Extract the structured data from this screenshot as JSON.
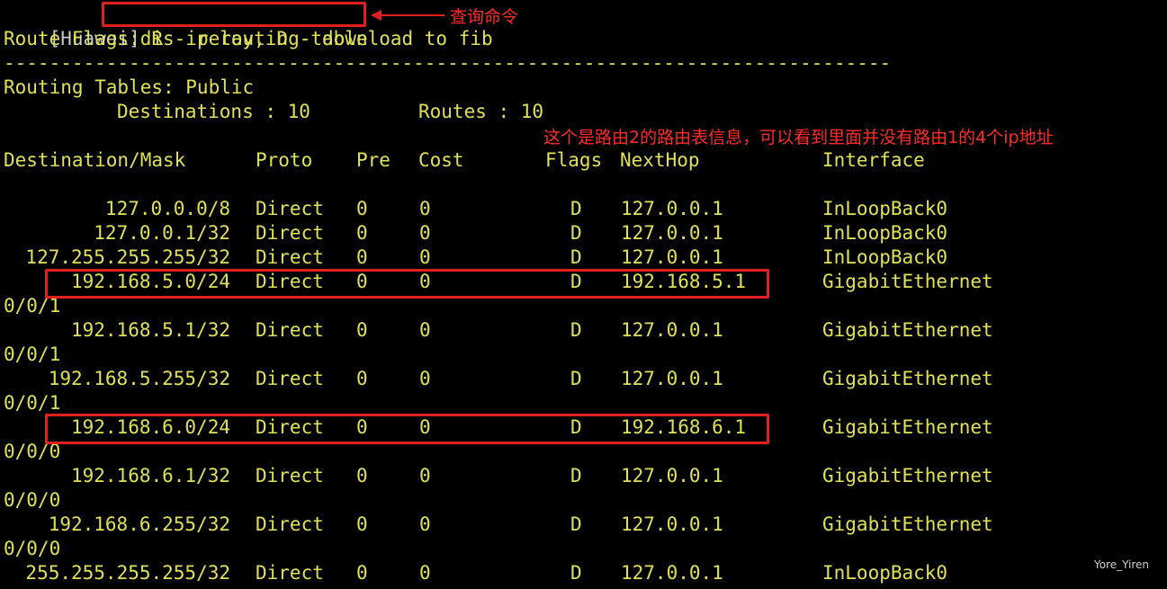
{
  "prompt": "[Huawei]",
  "command": "dis ip routing-table",
  "flags_legend": "Route Flags: R - relay, D - download to fib",
  "separator": "------------------------------------------------------------------------------",
  "routing_tables": "Routing Tables: Public",
  "destinations_label": "Destinations : 10",
  "routes_label": "Routes : 10",
  "headers": [
    "Destination/Mask",
    "Proto",
    "Pre",
    "Cost",
    "Flags",
    "NextHop",
    "Interface"
  ],
  "routes": [
    {
      "dest": "127.0.0.0/8",
      "proto": "Direct",
      "pre": "0",
      "cost": "0",
      "flags": "D",
      "nexthop": "127.0.0.1",
      "iface": "InLoopBack0",
      "iface2": ""
    },
    {
      "dest": "127.0.0.1/32",
      "proto": "Direct",
      "pre": "0",
      "cost": "0",
      "flags": "D",
      "nexthop": "127.0.0.1",
      "iface": "InLoopBack0",
      "iface2": ""
    },
    {
      "dest": "127.255.255.255/32",
      "proto": "Direct",
      "pre": "0",
      "cost": "0",
      "flags": "D",
      "nexthop": "127.0.0.1",
      "iface": "InLoopBack0",
      "iface2": ""
    },
    {
      "dest": "192.168.5.0/24",
      "proto": "Direct",
      "pre": "0",
      "cost": "0",
      "flags": "D",
      "nexthop": "192.168.5.1",
      "iface": "GigabitEthernet",
      "iface2": "0/0/1"
    },
    {
      "dest": "192.168.5.1/32",
      "proto": "Direct",
      "pre": "0",
      "cost": "0",
      "flags": "D",
      "nexthop": "127.0.0.1",
      "iface": "GigabitEthernet",
      "iface2": "0/0/1"
    },
    {
      "dest": "192.168.5.255/32",
      "proto": "Direct",
      "pre": "0",
      "cost": "0",
      "flags": "D",
      "nexthop": "127.0.0.1",
      "iface": "GigabitEthernet",
      "iface2": "0/0/1"
    },
    {
      "dest": "192.168.6.0/24",
      "proto": "Direct",
      "pre": "0",
      "cost": "0",
      "flags": "D",
      "nexthop": "192.168.6.1",
      "iface": "GigabitEthernet",
      "iface2": "0/0/0"
    },
    {
      "dest": "192.168.6.1/32",
      "proto": "Direct",
      "pre": "0",
      "cost": "0",
      "flags": "D",
      "nexthop": "127.0.0.1",
      "iface": "GigabitEthernet",
      "iface2": "0/0/0"
    },
    {
      "dest": "192.168.6.255/32",
      "proto": "Direct",
      "pre": "0",
      "cost": "0",
      "flags": "D",
      "nexthop": "127.0.0.1",
      "iface": "GigabitEthernet",
      "iface2": "0/0/0"
    },
    {
      "dest": "255.255.255.255/32",
      "proto": "Direct",
      "pre": "0",
      "cost": "0",
      "flags": "D",
      "nexthop": "127.0.0.1",
      "iface": "InLoopBack0",
      "iface2": ""
    }
  ],
  "annotations": {
    "command_note": "查询命令",
    "table_note": "这个是路由2的路由表信息，可以看到里面并没有路由1的4个ip地址",
    "color": "#ff2a2a"
  },
  "watermark": "Yore_Yiren"
}
